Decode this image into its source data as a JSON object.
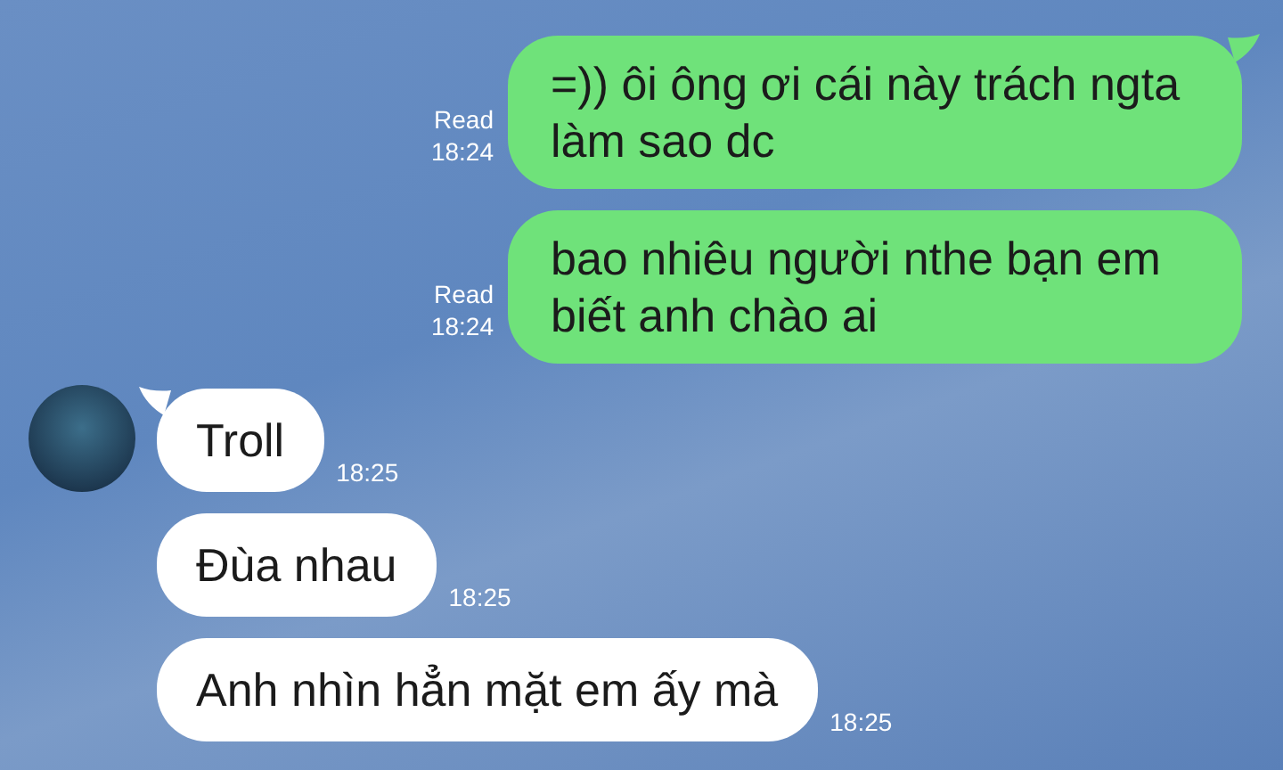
{
  "messages": [
    {
      "kind": "sent",
      "tail": true,
      "text": "=)) ôi ông ơi cái này trách ngta làm sao dc",
      "read": "Read",
      "time": "18:24"
    },
    {
      "kind": "sent",
      "tail": false,
      "text": "bao nhiêu người nthe bạn em biết anh chào ai",
      "read": "Read",
      "time": "18:24"
    },
    {
      "kind": "received",
      "tail": true,
      "text": "Troll",
      "time": "18:25"
    },
    {
      "kind": "received",
      "tail": false,
      "text": "Đùa nhau",
      "time": "18:25"
    },
    {
      "kind": "received",
      "tail": false,
      "text": "Anh nhìn hẳn mặt em ấy mà",
      "time": "18:25"
    }
  ]
}
